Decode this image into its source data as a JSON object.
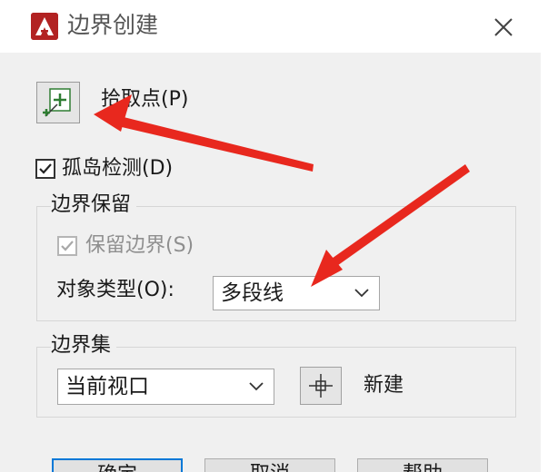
{
  "window": {
    "title": "边界创建",
    "app_icon": "autocad-icon",
    "close_icon": "close-icon"
  },
  "pick_points": {
    "label": "拾取点(P)",
    "icon": "pick-points-icon"
  },
  "island_detection": {
    "label": "孤岛检测(D)",
    "checked": true
  },
  "boundary_retention": {
    "title": "边界保留",
    "retain_label": "保留边界(S)",
    "retain_checked": true,
    "retain_enabled": false,
    "object_type_label": "对象类型(O):",
    "object_type_value": "多段线"
  },
  "boundary_set": {
    "title": "边界集",
    "current_value": "当前视口",
    "new_label": "新建",
    "new_icon": "crosshair-icon"
  },
  "buttons": {
    "ok": "确定",
    "cancel": "取消",
    "help": "帮助"
  },
  "colors": {
    "annotation_arrow": "#e8281e",
    "accent": "#0078d7",
    "autocad_red": "#b22222"
  }
}
